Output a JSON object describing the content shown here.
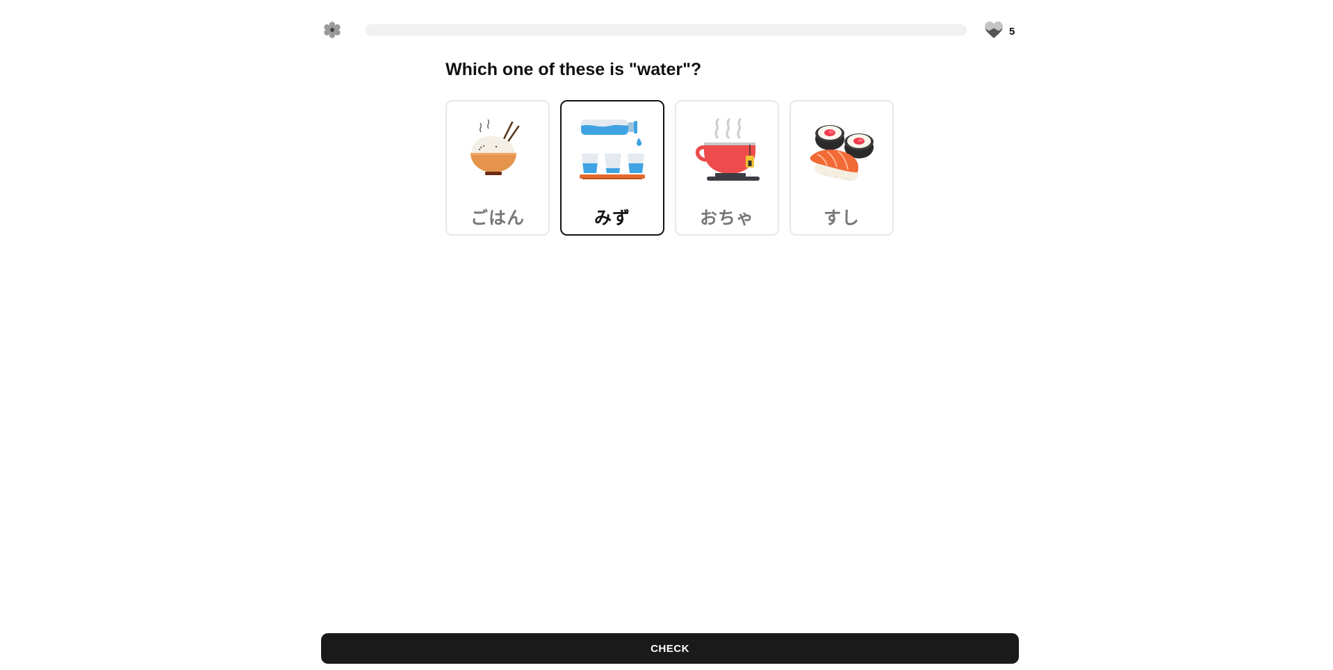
{
  "header": {
    "settings_icon": "gear-icon",
    "progress_fraction": 0.0,
    "hearts_icon": "heart-icon",
    "hearts_count": "5"
  },
  "question": {
    "text": "Which one of these is \"water\"?"
  },
  "choices": [
    {
      "label": "ごはん",
      "icon": "rice-bowl-icon",
      "selected": false
    },
    {
      "label": "みず",
      "icon": "water-bottle-cups-icon",
      "selected": true
    },
    {
      "label": "おちゃ",
      "icon": "tea-cup-icon",
      "selected": false
    },
    {
      "label": "すし",
      "icon": "sushi-icon",
      "selected": false
    }
  ],
  "footer": {
    "check_label": "CHECK"
  },
  "colors": {
    "accent": "#1a1a1a",
    "card_border": "#e8e8e8",
    "selected_border": "#111111",
    "progress_track": "#f1f1f1"
  }
}
